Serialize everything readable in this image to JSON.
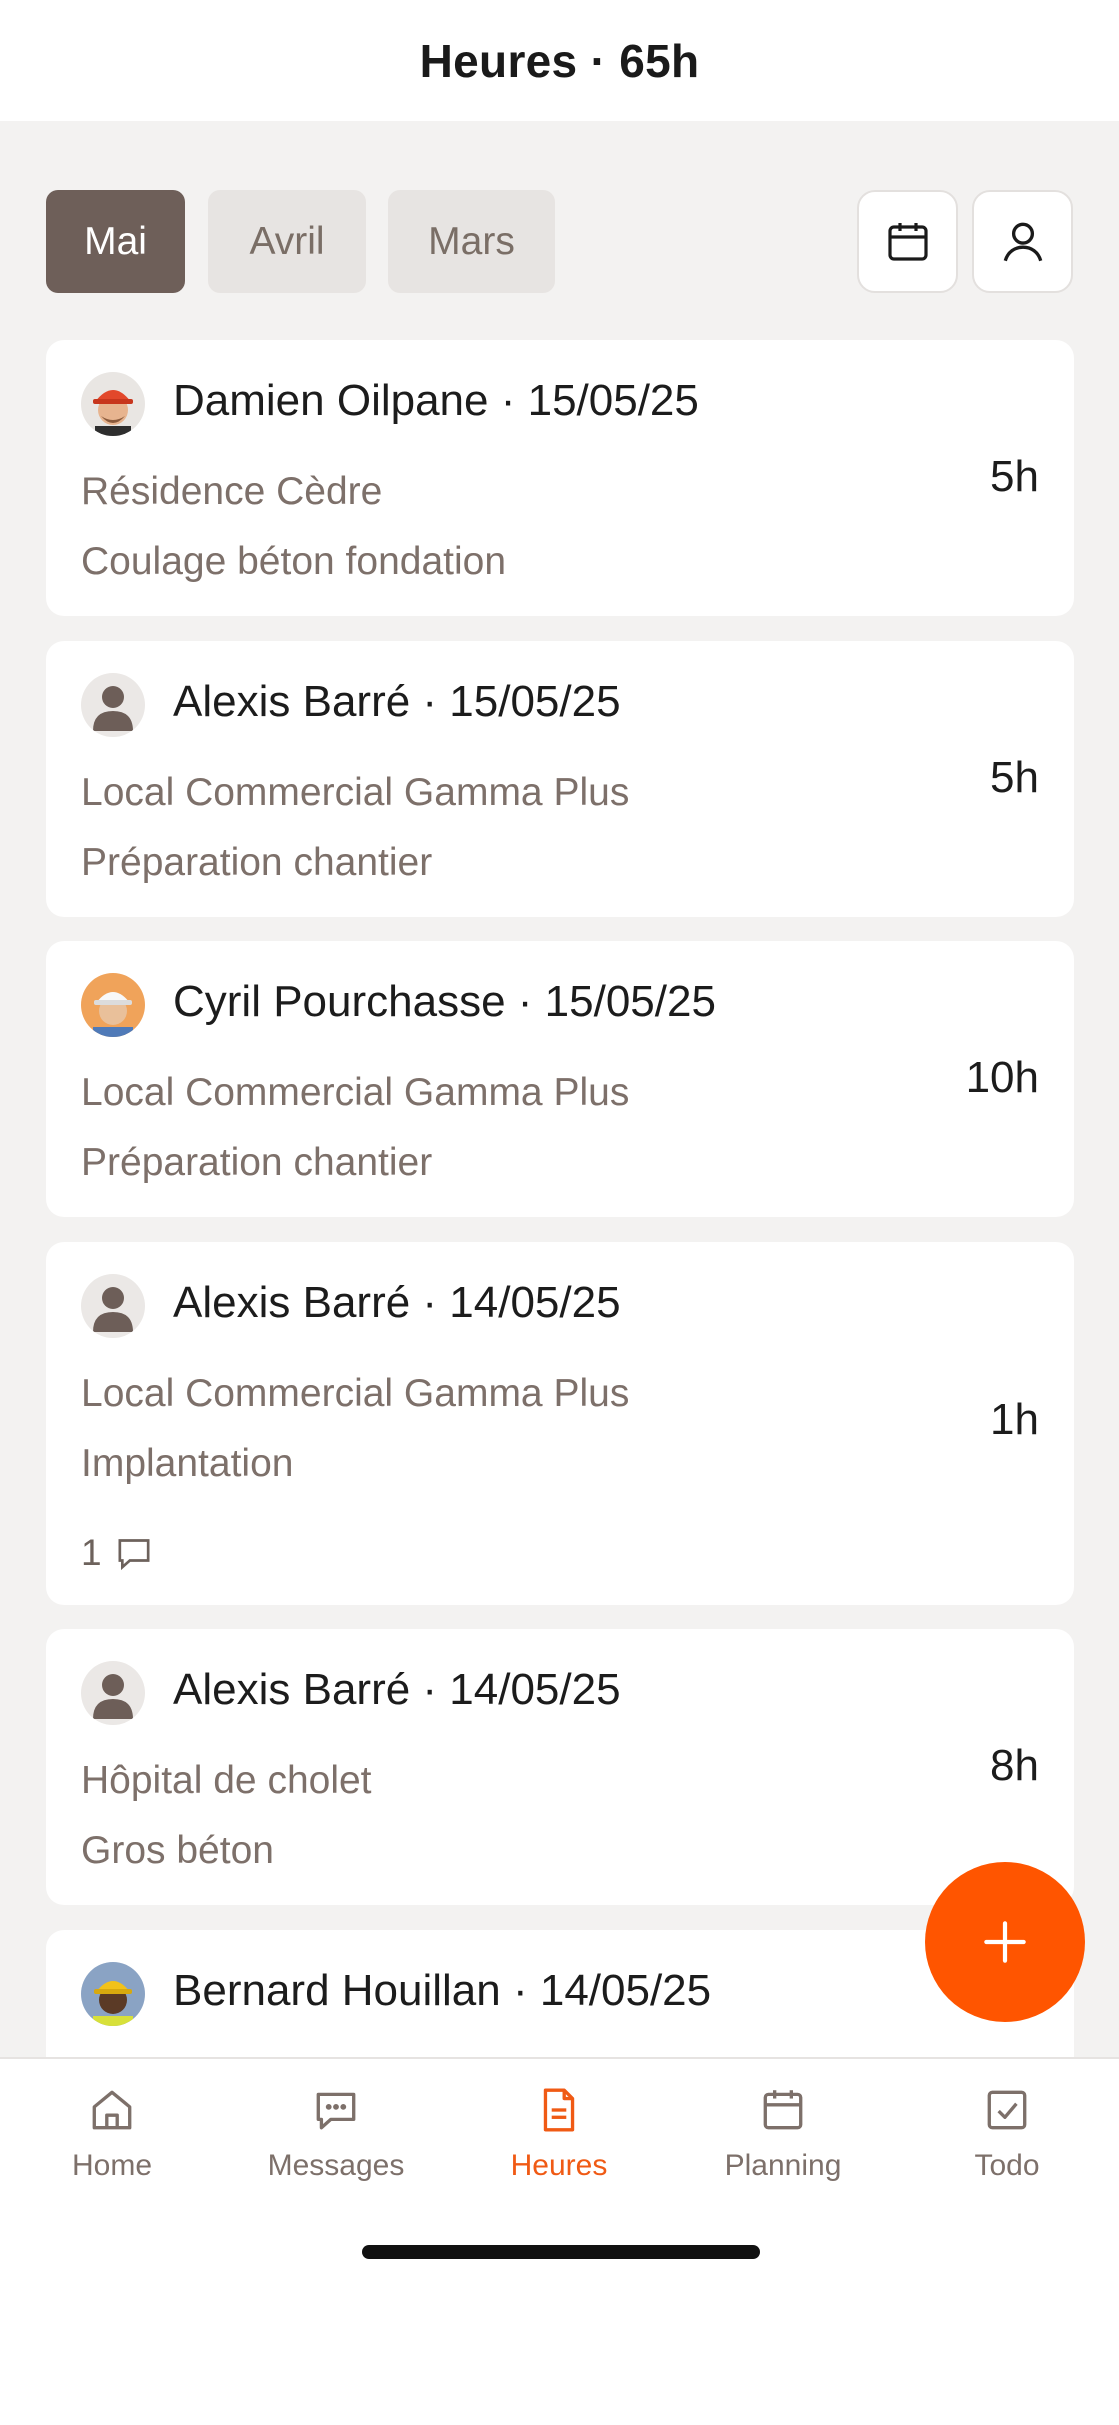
{
  "header": {
    "title": "Heures · 65h"
  },
  "filters": {
    "months": [
      {
        "label": "Mai",
        "active": true
      },
      {
        "label": "Avril",
        "active": false
      },
      {
        "label": "Mars",
        "active": false
      }
    ],
    "calendar_icon": "calendar-icon",
    "user_icon": "user-icon"
  },
  "entries": [
    {
      "title": "Damien Oilpane · 15/05/25",
      "site": "Résidence Cèdre",
      "task": "Coulage béton fondation",
      "hours": "5h",
      "avatar": "worker-red-helmet"
    },
    {
      "title": "Alexis Barré · 15/05/25",
      "site": "Local Commercial Gamma Plus",
      "task": "Préparation chantier",
      "hours": "5h",
      "avatar": "default-person"
    },
    {
      "title": "Cyril Pourchasse · 15/05/25",
      "site": "Local Commercial Gamma Plus",
      "task": "Préparation chantier",
      "hours": "10h",
      "avatar": "worker-white-helmet"
    },
    {
      "title": "Alexis Barré · 14/05/25",
      "site": "Local Commercial Gamma Plus",
      "task": "Implantation",
      "hours": "1h",
      "comments": "1",
      "avatar": "default-person"
    },
    {
      "title": "Alexis Barré · 14/05/25",
      "site": "Hôpital de cholet",
      "task": "Gros béton",
      "hours": "8h",
      "avatar": "default-person"
    },
    {
      "title": "Bernard Houillan · 14/05/25",
      "avatar": "worker-yellow-helmet"
    }
  ],
  "tabbar": {
    "items": [
      {
        "label": "Home",
        "icon": "home-icon"
      },
      {
        "label": "Messages",
        "icon": "message-icon"
      },
      {
        "label": "Heures",
        "icon": "document-icon",
        "active": true
      },
      {
        "label": "Planning",
        "icon": "calendar-icon"
      },
      {
        "label": "Todo",
        "icon": "checkbox-icon"
      }
    ]
  },
  "colors": {
    "accent": "#ff5500",
    "active_tab": "#6e5f59",
    "muted_text": "#7d706a"
  }
}
